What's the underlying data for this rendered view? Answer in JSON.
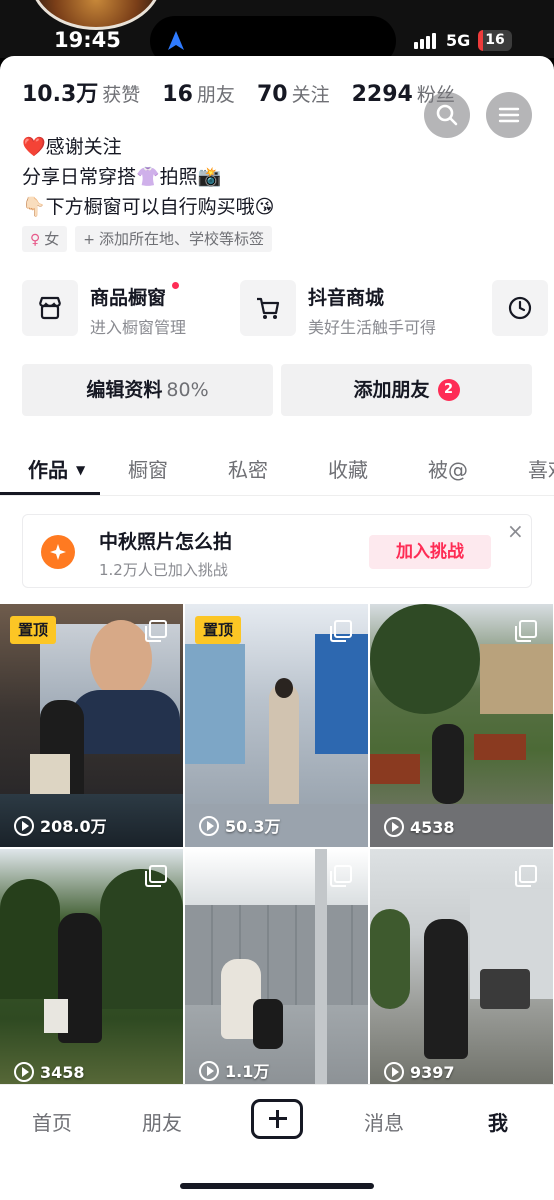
{
  "status": {
    "time": "19:45",
    "network": "5G",
    "battery": "16",
    "battery_level_percent": 16
  },
  "stats": [
    {
      "num": "10.3万",
      "label": "获赞"
    },
    {
      "num": "16",
      "label": "朋友"
    },
    {
      "num": "70",
      "label": "关注"
    },
    {
      "num": "2294",
      "label": "粉丝"
    }
  ],
  "bio": {
    "line1": "❤️感谢关注",
    "line2": "分享日常穿搭👚拍照📸",
    "line3": "👇🏻下方橱窗可以自行购买哦😘"
  },
  "tags": {
    "gender": "女",
    "gender_icon": "♀",
    "location": "添加所在地、学校等标签",
    "location_icon": "+"
  },
  "shop": {
    "window_title": "商品橱窗",
    "window_sub": "进入橱窗管理",
    "mall_title": "抖音商城",
    "mall_sub": "美好生活触手可得"
  },
  "actions": {
    "edit_label": "编辑资料",
    "edit_progress": "80%",
    "add_friend_label": "添加朋友",
    "add_friend_badge": "2"
  },
  "tabs": [
    {
      "label": "作品"
    },
    {
      "label": "橱窗"
    },
    {
      "label": "私密"
    },
    {
      "label": "收藏"
    },
    {
      "label": "被@"
    },
    {
      "label": "喜欢"
    }
  ],
  "challenge": {
    "title": "中秋照片怎么拍",
    "subtitle": "1.2万人已加入挑战",
    "button": "加入挑战",
    "close": "×"
  },
  "posts": [
    {
      "plays": "208.0万",
      "pinned": "置顶"
    },
    {
      "plays": "50.3万",
      "pinned": "置顶"
    },
    {
      "plays": "4538",
      "pinned": ""
    },
    {
      "plays": "3458",
      "pinned": ""
    },
    {
      "plays": "1.1万",
      "pinned": ""
    },
    {
      "plays": "9397",
      "pinned": ""
    }
  ],
  "bottom_nav": {
    "home": "首页",
    "friends": "朋友",
    "messages": "消息",
    "me": "我"
  },
  "colors": {
    "accent": "#fe2c55",
    "pin": "#fcc625",
    "challenge_icon": "#ff7a21"
  }
}
